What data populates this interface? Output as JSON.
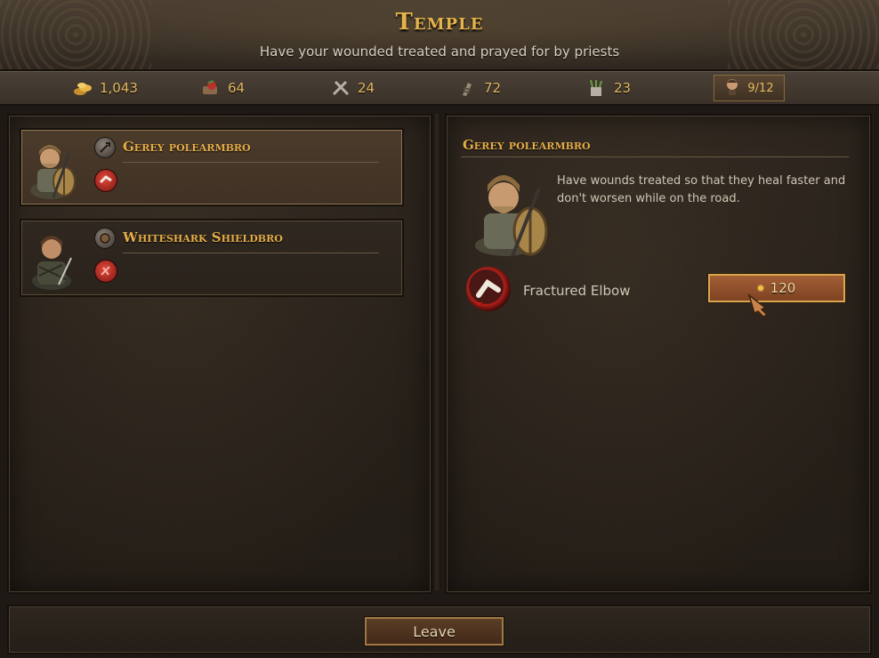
{
  "header": {
    "title": "Temple",
    "subtitle": "Have your wounded treated and prayed for by priests"
  },
  "resources": {
    "crowns": "1,043",
    "food": "64",
    "tools": "24",
    "medicine": "72",
    "ammo": "23",
    "roster": "9/12"
  },
  "brothers": [
    {
      "name": "Gerey polearmbro",
      "role_icon": "polearm-icon",
      "wound_icon": "wound-icon"
    },
    {
      "name": "Whiteshark Shieldbro",
      "role_icon": "shield-icon",
      "wound_icon": "wound-icon"
    }
  ],
  "detail": {
    "name": "Gerey polearmbro",
    "description": "Have wounds treated so that they heal faster and don't worsen while on the road.",
    "injury": "Fractured Elbow",
    "cost": "120"
  },
  "footer": {
    "leave_label": "Leave"
  },
  "colors": {
    "gold_text": "#e4ad48",
    "button_border": "#d8a64e",
    "wound_red": "#b3201a"
  }
}
